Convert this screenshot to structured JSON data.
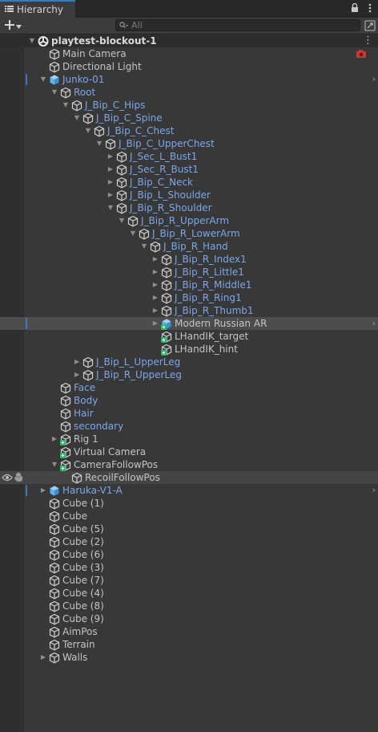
{
  "window": {
    "tab_title": "Hierarchy"
  },
  "search": {
    "placeholder": "All"
  },
  "colors": {
    "accent": "#3a79bb",
    "prefab_text": "#7ba7e8",
    "panel_bg": "#383838"
  },
  "tree": [
    {
      "label": "playtest-blockout-1",
      "depth": 0,
      "arrow": "down",
      "icon": "unity-scene-icon",
      "style": "scene",
      "menu": true
    },
    {
      "label": "Main Camera",
      "depth": 1,
      "icon": "gameobject-icon",
      "badge": true
    },
    {
      "label": "Directional Light",
      "depth": 1,
      "icon": "gameobject-icon"
    },
    {
      "label": "Junko-01",
      "depth": 1,
      "arrow": "down",
      "icon": "prefab-icon",
      "style": "prefab",
      "mark": true,
      "chevron": true
    },
    {
      "label": "Root",
      "depth": 2,
      "arrow": "down",
      "icon": "gameobject-icon",
      "style": "prefab"
    },
    {
      "label": "J_Bip_C_Hips",
      "depth": 3,
      "arrow": "down",
      "icon": "gameobject-icon",
      "style": "prefab"
    },
    {
      "label": "J_Bip_C_Spine",
      "depth": 4,
      "arrow": "down",
      "icon": "gameobject-icon",
      "style": "prefab"
    },
    {
      "label": "J_Bip_C_Chest",
      "depth": 5,
      "arrow": "down",
      "icon": "gameobject-icon",
      "style": "prefab"
    },
    {
      "label": "J_Bip_C_UpperChest",
      "depth": 6,
      "arrow": "down",
      "icon": "gameobject-icon",
      "style": "prefab"
    },
    {
      "label": "J_Sec_L_Bust1",
      "depth": 7,
      "arrow": "right",
      "icon": "gameobject-icon",
      "style": "prefab"
    },
    {
      "label": "J_Sec_R_Bust1",
      "depth": 7,
      "arrow": "right",
      "icon": "gameobject-icon",
      "style": "prefab"
    },
    {
      "label": "J_Bip_C_Neck",
      "depth": 7,
      "arrow": "right",
      "icon": "gameobject-icon",
      "style": "prefab"
    },
    {
      "label": "J_Bip_L_Shoulder",
      "depth": 7,
      "arrow": "right",
      "icon": "gameobject-icon",
      "style": "prefab"
    },
    {
      "label": "J_Bip_R_Shoulder",
      "depth": 7,
      "arrow": "down",
      "icon": "gameobject-icon",
      "style": "prefab"
    },
    {
      "label": "J_Bip_R_UpperArm",
      "depth": 8,
      "arrow": "down",
      "icon": "gameobject-icon",
      "style": "prefab"
    },
    {
      "label": "J_Bip_R_LowerArm",
      "depth": 9,
      "arrow": "down",
      "icon": "gameobject-icon",
      "style": "prefab"
    },
    {
      "label": "J_Bip_R_Hand",
      "depth": 10,
      "arrow": "down",
      "icon": "gameobject-icon",
      "style": "prefab"
    },
    {
      "label": "J_Bip_R_Index1",
      "depth": 11,
      "arrow": "right",
      "icon": "gameobject-icon",
      "style": "prefab"
    },
    {
      "label": "J_Bip_R_Little1",
      "depth": 11,
      "arrow": "right",
      "icon": "gameobject-icon",
      "style": "prefab"
    },
    {
      "label": "J_Bip_R_Middle1",
      "depth": 11,
      "arrow": "right",
      "icon": "gameobject-icon",
      "style": "prefab"
    },
    {
      "label": "J_Bip_R_Ring1",
      "depth": 11,
      "arrow": "right",
      "icon": "gameobject-icon",
      "style": "prefab"
    },
    {
      "label": "J_Bip_R_Thumb1",
      "depth": 11,
      "arrow": "right",
      "icon": "gameobject-icon",
      "style": "prefab"
    },
    {
      "label": "Modern Russian AR",
      "depth": 11,
      "arrow": "right",
      "icon": "prefab-script-icon",
      "selected": true,
      "mark": true,
      "chevron": true
    },
    {
      "label": "LHandIK_target",
      "depth": 11,
      "icon": "script-gameobject-icon"
    },
    {
      "label": "LHandIK_hint",
      "depth": 11,
      "icon": "script-gameobject-icon"
    },
    {
      "label": "J_Bip_L_UpperLeg",
      "depth": 4,
      "arrow": "right",
      "icon": "gameobject-icon",
      "style": "prefab"
    },
    {
      "label": "J_Bip_R_UpperLeg",
      "depth": 4,
      "arrow": "right",
      "icon": "gameobject-icon",
      "style": "prefab"
    },
    {
      "label": "Face",
      "depth": 2,
      "icon": "gameobject-icon",
      "style": "prefab"
    },
    {
      "label": "Body",
      "depth": 2,
      "icon": "gameobject-icon",
      "style": "prefab"
    },
    {
      "label": "Hair",
      "depth": 2,
      "icon": "gameobject-icon",
      "style": "prefab"
    },
    {
      "label": "secondary",
      "depth": 2,
      "icon": "gameobject-icon",
      "style": "prefab"
    },
    {
      "label": "Rig 1",
      "depth": 2,
      "arrow": "right",
      "icon": "script-gameobject-icon"
    },
    {
      "label": "Virtual Camera",
      "depth": 2,
      "icon": "script-gameobject-icon"
    },
    {
      "label": "CameraFollowPos",
      "depth": 2,
      "arrow": "down",
      "icon": "script-gameobject-icon"
    },
    {
      "label": "RecoilFollowPos",
      "depth": 3,
      "icon": "gameobject-icon",
      "hover": true,
      "eye": true
    },
    {
      "label": "Haruka-V1-A",
      "depth": 1,
      "arrow": "right",
      "icon": "prefab-icon",
      "style": "prefab",
      "mark": true,
      "chevron": true
    },
    {
      "label": "Cube (1)",
      "depth": 1,
      "icon": "gameobject-icon"
    },
    {
      "label": "Cube",
      "depth": 1,
      "icon": "gameobject-icon"
    },
    {
      "label": "Cube (5)",
      "depth": 1,
      "icon": "gameobject-icon"
    },
    {
      "label": "Cube (2)",
      "depth": 1,
      "icon": "gameobject-icon"
    },
    {
      "label": "Cube (6)",
      "depth": 1,
      "icon": "gameobject-icon"
    },
    {
      "label": "Cube (3)",
      "depth": 1,
      "icon": "gameobject-icon"
    },
    {
      "label": "Cube (7)",
      "depth": 1,
      "icon": "gameobject-icon"
    },
    {
      "label": "Cube (4)",
      "depth": 1,
      "icon": "gameobject-icon"
    },
    {
      "label": "Cube (8)",
      "depth": 1,
      "icon": "gameobject-icon"
    },
    {
      "label": "Cube (9)",
      "depth": 1,
      "icon": "gameobject-icon"
    },
    {
      "label": "AimPos",
      "depth": 1,
      "icon": "gameobject-icon"
    },
    {
      "label": "Terrain",
      "depth": 1,
      "icon": "gameobject-icon"
    },
    {
      "label": "Walls",
      "depth": 1,
      "arrow": "right",
      "icon": "gameobject-icon"
    }
  ]
}
